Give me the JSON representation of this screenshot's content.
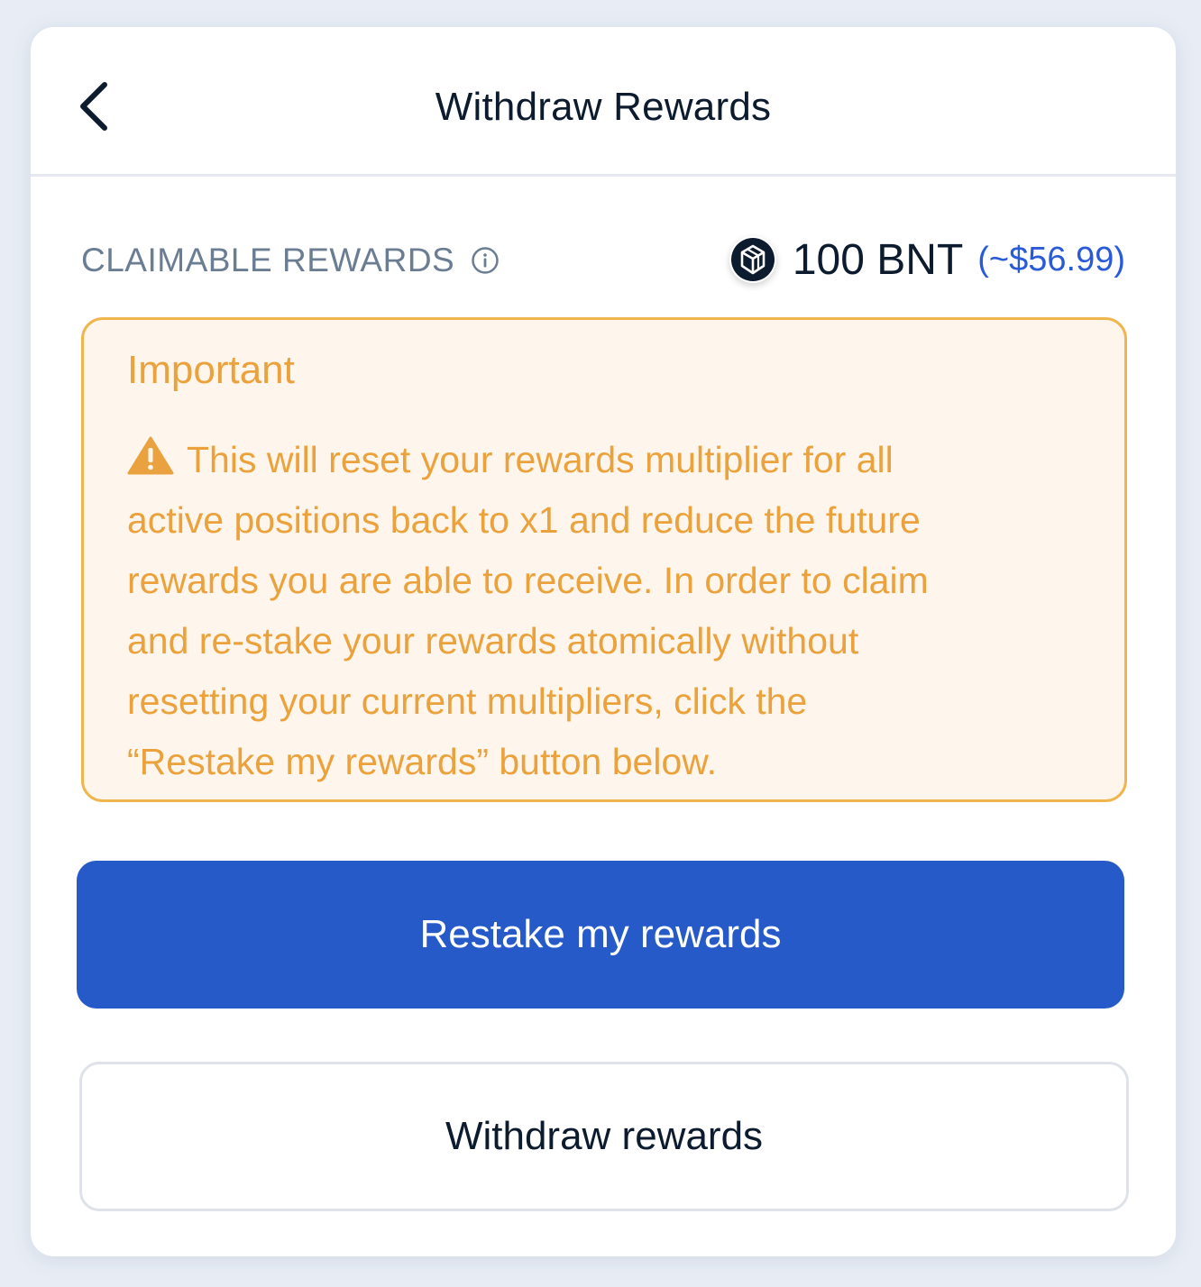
{
  "header": {
    "title": "Withdraw Rewards",
    "back_icon": "chevron-left-icon"
  },
  "claimable": {
    "label": "CLAIMABLE REWARDS",
    "info_icon": "info-icon",
    "token_icon": "bnt-token-icon",
    "amount": "100 BNT",
    "usd_value": "(~$56.99)"
  },
  "warning": {
    "title": "Important",
    "icon": "warning-triangle-icon",
    "line1": "This will reset your rewards multiplier for all",
    "line2": "active positions back to x1 and reduce the future",
    "line3": "rewards you are able to receive. In order to claim",
    "line4": "and re-stake your rewards atomically without",
    "line5": "resetting your current multipliers, click the",
    "line6": "“Restake my rewards” button below."
  },
  "actions": {
    "restake_label": "Restake my rewards",
    "withdraw_label": "Withdraw rewards"
  },
  "colors": {
    "primary": "#255ac8",
    "warning": "#eba23c",
    "warning_bg": "#fef6ec",
    "text_dark": "#0d1b2e",
    "text_muted": "#6b7d93"
  }
}
